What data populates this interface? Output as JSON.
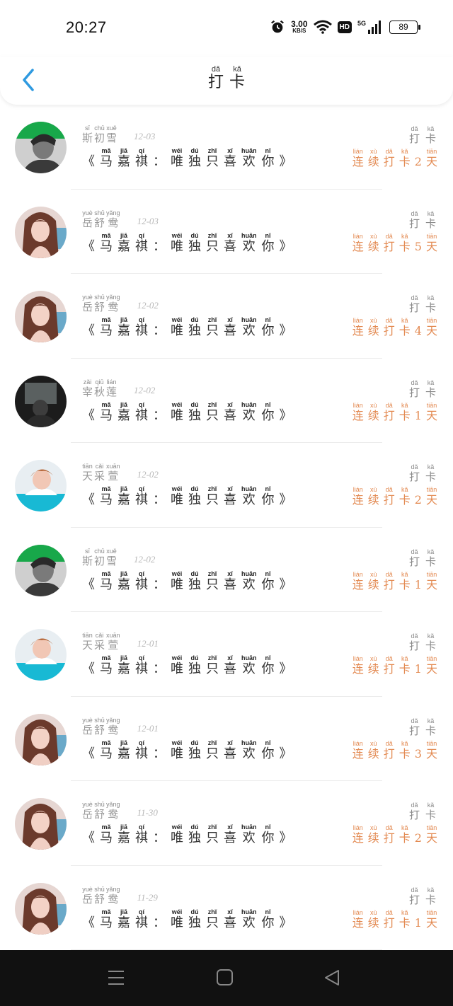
{
  "status_bar": {
    "time": "20:27",
    "net_speed_value": "3.00",
    "net_speed_unit": "KB/S",
    "hd_label": "HD",
    "signal_label": "5G",
    "battery_level": "89"
  },
  "header": {
    "back_icon": "chevron-left-icon",
    "title": [
      {
        "py": "dǎ",
        "hz": "打"
      },
      {
        "py": "kǎ",
        "hz": "卡"
      }
    ]
  },
  "checkin_tag": [
    {
      "py": "dǎ",
      "hz": "打"
    },
    {
      "py": "kǎ",
      "hz": "卡"
    }
  ],
  "content_text": [
    {
      "py": "",
      "hz": "《"
    },
    {
      "py": "mǎ",
      "hz": "马"
    },
    {
      "py": "jiā",
      "hz": "嘉"
    },
    {
      "py": "qí",
      "hz": "祺"
    },
    {
      "py": "",
      "hz": "："
    },
    {
      "py": "wéi",
      "hz": "唯"
    },
    {
      "py": "dú",
      "hz": "独"
    },
    {
      "py": "zhǐ",
      "hz": "只"
    },
    {
      "py": "xǐ",
      "hz": "喜"
    },
    {
      "py": "huān",
      "hz": "欢"
    },
    {
      "py": "nǐ",
      "hz": "你"
    },
    {
      "py": "",
      "hz": "》"
    }
  ],
  "colors": {
    "accent_blue": "#2f9ae0",
    "streak_orange": "#e38a52"
  },
  "entries": [
    {
      "avatar": "avatar-boy-green-banner",
      "name": [
        {
          "py": "sī",
          "hz": "斯"
        },
        {
          "py": "chū",
          "hz": "初"
        },
        {
          "py": "xuě",
          "hz": "雪"
        }
      ],
      "date": "12-03",
      "streak": [
        {
          "py": "lián",
          "hz": "连"
        },
        {
          "py": "xù",
          "hz": "续"
        },
        {
          "py": "dǎ",
          "hz": "打"
        },
        {
          "py": "kǎ",
          "hz": "卡"
        },
        {
          "py": "",
          "hz": "2"
        },
        {
          "py": "tiān",
          "hz": "天"
        }
      ]
    },
    {
      "avatar": "avatar-girl-long-hair",
      "name": [
        {
          "py": "yuè",
          "hz": "岳"
        },
        {
          "py": "shū",
          "hz": "舒"
        },
        {
          "py": "yǎng",
          "hz": "鸯"
        }
      ],
      "date": "12-03",
      "streak": [
        {
          "py": "lián",
          "hz": "连"
        },
        {
          "py": "xù",
          "hz": "续"
        },
        {
          "py": "dǎ",
          "hz": "打"
        },
        {
          "py": "kǎ",
          "hz": "卡"
        },
        {
          "py": "",
          "hz": "5"
        },
        {
          "py": "tiān",
          "hz": "天"
        }
      ]
    },
    {
      "avatar": "avatar-girl-long-hair",
      "name": [
        {
          "py": "yuè",
          "hz": "岳"
        },
        {
          "py": "shū",
          "hz": "舒"
        },
        {
          "py": "yǎng",
          "hz": "鸯"
        }
      ],
      "date": "12-02",
      "streak": [
        {
          "py": "lián",
          "hz": "连"
        },
        {
          "py": "xù",
          "hz": "续"
        },
        {
          "py": "dǎ",
          "hz": "打"
        },
        {
          "py": "kǎ",
          "hz": "卡"
        },
        {
          "py": "",
          "hz": "4"
        },
        {
          "py": "tiān",
          "hz": "天"
        }
      ]
    },
    {
      "avatar": "avatar-dark-figure",
      "name": [
        {
          "py": "zǎi",
          "hz": "宰"
        },
        {
          "py": "qiū",
          "hz": "秋"
        },
        {
          "py": "lián",
          "hz": "莲"
        }
      ],
      "date": "12-02",
      "streak": [
        {
          "py": "lián",
          "hz": "连"
        },
        {
          "py": "xù",
          "hz": "续"
        },
        {
          "py": "dǎ",
          "hz": "打"
        },
        {
          "py": "kǎ",
          "hz": "卡"
        },
        {
          "py": "",
          "hz": "1"
        },
        {
          "py": "tiān",
          "hz": "天"
        }
      ]
    },
    {
      "avatar": "avatar-boy-cyan-banner",
      "name": [
        {
          "py": "tiān",
          "hz": "天"
        },
        {
          "py": "cǎi",
          "hz": "采"
        },
        {
          "py": "xuān",
          "hz": "萱"
        }
      ],
      "date": "12-02",
      "streak": [
        {
          "py": "lián",
          "hz": "连"
        },
        {
          "py": "xù",
          "hz": "续"
        },
        {
          "py": "dǎ",
          "hz": "打"
        },
        {
          "py": "kǎ",
          "hz": "卡"
        },
        {
          "py": "",
          "hz": "2"
        },
        {
          "py": "tiān",
          "hz": "天"
        }
      ]
    },
    {
      "avatar": "avatar-boy-green-banner",
      "name": [
        {
          "py": "sī",
          "hz": "斯"
        },
        {
          "py": "chū",
          "hz": "初"
        },
        {
          "py": "xuě",
          "hz": "雪"
        }
      ],
      "date": "12-02",
      "streak": [
        {
          "py": "lián",
          "hz": "连"
        },
        {
          "py": "xù",
          "hz": "续"
        },
        {
          "py": "dǎ",
          "hz": "打"
        },
        {
          "py": "kǎ",
          "hz": "卡"
        },
        {
          "py": "",
          "hz": "1"
        },
        {
          "py": "tiān",
          "hz": "天"
        }
      ]
    },
    {
      "avatar": "avatar-boy-cyan-banner",
      "name": [
        {
          "py": "tiān",
          "hz": "天"
        },
        {
          "py": "cǎi",
          "hz": "采"
        },
        {
          "py": "xuān",
          "hz": "萱"
        }
      ],
      "date": "12-01",
      "streak": [
        {
          "py": "lián",
          "hz": "连"
        },
        {
          "py": "xù",
          "hz": "续"
        },
        {
          "py": "dǎ",
          "hz": "打"
        },
        {
          "py": "kǎ",
          "hz": "卡"
        },
        {
          "py": "",
          "hz": "1"
        },
        {
          "py": "tiān",
          "hz": "天"
        }
      ]
    },
    {
      "avatar": "avatar-girl-long-hair",
      "name": [
        {
          "py": "yuè",
          "hz": "岳"
        },
        {
          "py": "shū",
          "hz": "舒"
        },
        {
          "py": "yǎng",
          "hz": "鸯"
        }
      ],
      "date": "12-01",
      "streak": [
        {
          "py": "lián",
          "hz": "连"
        },
        {
          "py": "xù",
          "hz": "续"
        },
        {
          "py": "dǎ",
          "hz": "打"
        },
        {
          "py": "kǎ",
          "hz": "卡"
        },
        {
          "py": "",
          "hz": "3"
        },
        {
          "py": "tiān",
          "hz": "天"
        }
      ]
    },
    {
      "avatar": "avatar-girl-long-hair",
      "name": [
        {
          "py": "yuè",
          "hz": "岳"
        },
        {
          "py": "shū",
          "hz": "舒"
        },
        {
          "py": "yǎng",
          "hz": "鸯"
        }
      ],
      "date": "11-30",
      "streak": [
        {
          "py": "lián",
          "hz": "连"
        },
        {
          "py": "xù",
          "hz": "续"
        },
        {
          "py": "dǎ",
          "hz": "打"
        },
        {
          "py": "kǎ",
          "hz": "卡"
        },
        {
          "py": "",
          "hz": "2"
        },
        {
          "py": "tiān",
          "hz": "天"
        }
      ]
    },
    {
      "avatar": "avatar-girl-long-hair",
      "name": [
        {
          "py": "yuè",
          "hz": "岳"
        },
        {
          "py": "shū",
          "hz": "舒"
        },
        {
          "py": "yǎng",
          "hz": "鸯"
        }
      ],
      "date": "11-29",
      "streak": [
        {
          "py": "lián",
          "hz": "连"
        },
        {
          "py": "xù",
          "hz": "续"
        },
        {
          "py": "dǎ",
          "hz": "打"
        },
        {
          "py": "kǎ",
          "hz": "卡"
        },
        {
          "py": "",
          "hz": "1"
        },
        {
          "py": "tiān",
          "hz": "天"
        }
      ]
    }
  ],
  "nav": {
    "recents_icon": "recents-menu-icon",
    "home_icon": "home-square-icon",
    "back_icon": "back-triangle-icon"
  }
}
